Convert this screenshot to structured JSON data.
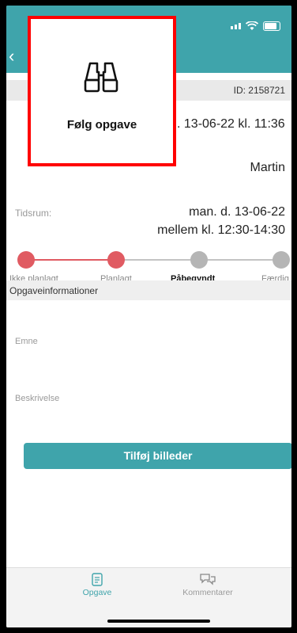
{
  "header": {
    "back_glyph": "‹"
  },
  "idbar": {
    "id_text": "ID: 2158721"
  },
  "task": {
    "date_line": ". 13-06-22 kl. 11:36",
    "assignee": "Martin",
    "timespan_label": "Tidsrum:",
    "timespan_date": "man. d. 13-06-22",
    "timespan_time": "mellem kl. 12:30-14:30"
  },
  "progress": {
    "steps": [
      "Ikke planlagt",
      "Planlagt",
      "Påbegyndt",
      "Færdig"
    ],
    "completed_steps": 2,
    "colors": {
      "done": "#e05b62",
      "todo": "#b5b5b5"
    }
  },
  "info": {
    "section_title": "Opgaveinformationer",
    "subject_label": "Emne",
    "description_label": "Beskrivelse",
    "add_images_label": "Tilføj billeder"
  },
  "tabbar": {
    "tabs": [
      {
        "label": "Opgave",
        "icon": "document-icon",
        "active": true
      },
      {
        "label": "Kommentarer",
        "icon": "chat-icon",
        "active": false
      }
    ]
  },
  "overlay": {
    "label": "Følg opgave",
    "icon": "binoculars-icon"
  },
  "colors": {
    "accent": "#3fa4ab",
    "highlight": "#ff0000"
  }
}
